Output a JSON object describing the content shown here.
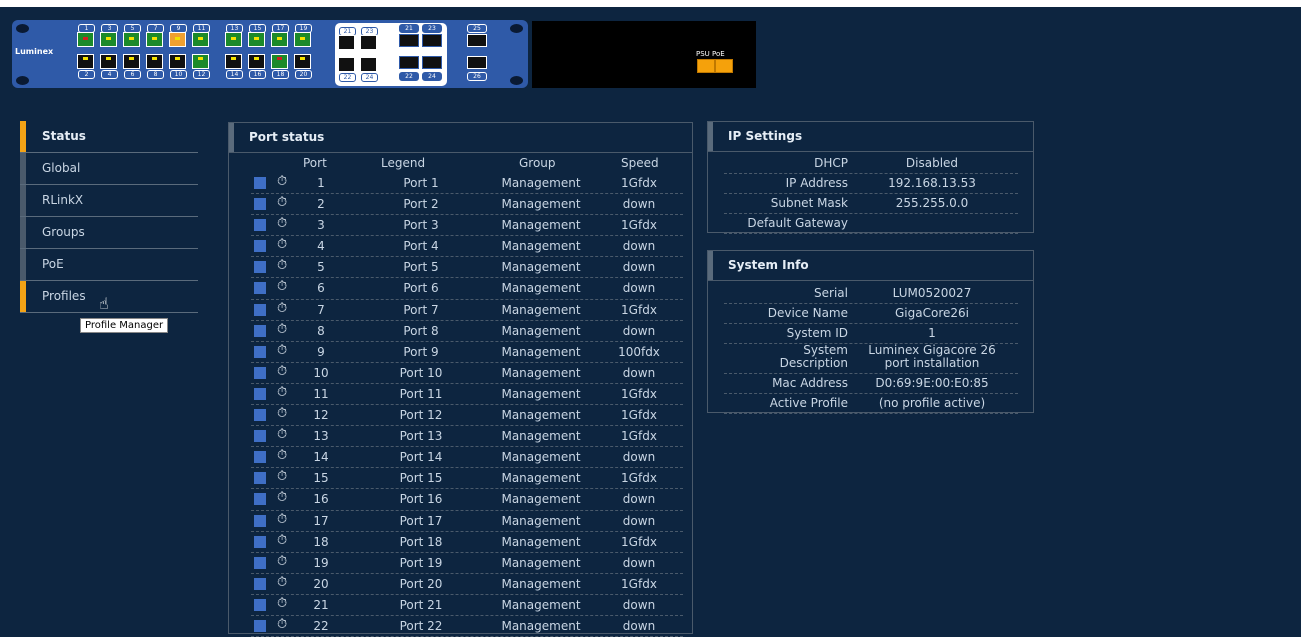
{
  "device": {
    "brand": "Luminex",
    "ports_top": [
      {
        "n": "1",
        "jack": "green",
        "led": "red"
      },
      {
        "n": "3",
        "jack": "green",
        "led": "yellow"
      },
      {
        "n": "5",
        "jack": "green",
        "led": "yellow"
      },
      {
        "n": "7",
        "jack": "green",
        "led": "yellow"
      },
      {
        "n": "9",
        "jack": "orange",
        "led": "yellow"
      },
      {
        "n": "11",
        "jack": "green",
        "led": "yellow"
      },
      {
        "n": "13",
        "jack": "green",
        "led": "yellow"
      },
      {
        "n": "15",
        "jack": "green",
        "led": "yellow"
      },
      {
        "n": "17",
        "jack": "green",
        "led": "yellow"
      },
      {
        "n": "19",
        "jack": "green",
        "led": "yellow"
      }
    ],
    "ports_bottom": [
      {
        "n": "2",
        "jack": "black",
        "led": "yellow"
      },
      {
        "n": "4",
        "jack": "black",
        "led": "yellow"
      },
      {
        "n": "6",
        "jack": "black",
        "led": "yellow"
      },
      {
        "n": "8",
        "jack": "black",
        "led": "yellow"
      },
      {
        "n": "10",
        "jack": "black",
        "led": "yellow"
      },
      {
        "n": "12",
        "jack": "green",
        "led": "yellow"
      },
      {
        "n": "14",
        "jack": "black",
        "led": "yellow"
      },
      {
        "n": "16",
        "jack": "black",
        "led": "yellow"
      },
      {
        "n": "18",
        "jack": "green",
        "led": "red"
      },
      {
        "n": "20",
        "jack": "black",
        "led": "yellow"
      }
    ],
    "combo_top": [
      "21",
      "23"
    ],
    "combo_bottom": [
      "22",
      "24"
    ],
    "sfp_top": [
      "21",
      "23"
    ],
    "sfp_bottom": [
      "22",
      "24"
    ],
    "sfp_extra_top": "25",
    "sfp_extra_bottom": "26",
    "psu_label": "PSU PoE"
  },
  "sidebar": {
    "items": [
      {
        "label": "Status",
        "active": true
      },
      {
        "label": "Global",
        "active": false
      },
      {
        "label": "RLinkX",
        "active": false
      },
      {
        "label": "Groups",
        "active": false
      },
      {
        "label": "PoE",
        "active": false
      },
      {
        "label": "Profiles",
        "active": true
      }
    ],
    "tooltip": "Profile Manager"
  },
  "port_status": {
    "title": "Port status",
    "columns": [
      "Port",
      "Legend",
      "Group",
      "Speed"
    ],
    "rows": [
      [
        "1",
        "Port 1",
        "Management",
        "1Gfdx"
      ],
      [
        "2",
        "Port 2",
        "Management",
        "down"
      ],
      [
        "3",
        "Port 3",
        "Management",
        "1Gfdx"
      ],
      [
        "4",
        "Port 4",
        "Management",
        "down"
      ],
      [
        "5",
        "Port 5",
        "Management",
        "down"
      ],
      [
        "6",
        "Port 6",
        "Management",
        "down"
      ],
      [
        "7",
        "Port 7",
        "Management",
        "1Gfdx"
      ],
      [
        "8",
        "Port 8",
        "Management",
        "down"
      ],
      [
        "9",
        "Port 9",
        "Management",
        "100fdx"
      ],
      [
        "10",
        "Port 10",
        "Management",
        "down"
      ],
      [
        "11",
        "Port 11",
        "Management",
        "1Gfdx"
      ],
      [
        "12",
        "Port 12",
        "Management",
        "1Gfdx"
      ],
      [
        "13",
        "Port 13",
        "Management",
        "1Gfdx"
      ],
      [
        "14",
        "Port 14",
        "Management",
        "down"
      ],
      [
        "15",
        "Port 15",
        "Management",
        "1Gfdx"
      ],
      [
        "16",
        "Port 16",
        "Management",
        "down"
      ],
      [
        "17",
        "Port 17",
        "Management",
        "down"
      ],
      [
        "18",
        "Port 18",
        "Management",
        "1Gfdx"
      ],
      [
        "19",
        "Port 19",
        "Management",
        "down"
      ],
      [
        "20",
        "Port 20",
        "Management",
        "1Gfdx"
      ],
      [
        "21",
        "Port 21",
        "Management",
        "down"
      ],
      [
        "22",
        "Port 22",
        "Management",
        "down"
      ]
    ]
  },
  "ip_settings": {
    "title": "IP Settings",
    "rows": [
      [
        "DHCP",
        "Disabled"
      ],
      [
        "IP Address",
        "192.168.13.53"
      ],
      [
        "Subnet Mask",
        "255.255.0.0"
      ],
      [
        "Default Gateway",
        ""
      ]
    ]
  },
  "system_info": {
    "title": "System Info",
    "rows": [
      [
        "Serial",
        "LUM0520027"
      ],
      [
        "Device Name",
        "GigaCore26i"
      ],
      [
        "System ID",
        "1"
      ],
      [
        "System Description",
        "Luminex Gigacore 26 port installation"
      ],
      [
        "Mac Address",
        "D0:69:9E:00:E0:85"
      ],
      [
        "Active Profile",
        "(no profile active)"
      ]
    ]
  },
  "colors": {
    "background": "#0d2540",
    "accent": "#f3a316",
    "port_square": "#3f6fc6"
  }
}
